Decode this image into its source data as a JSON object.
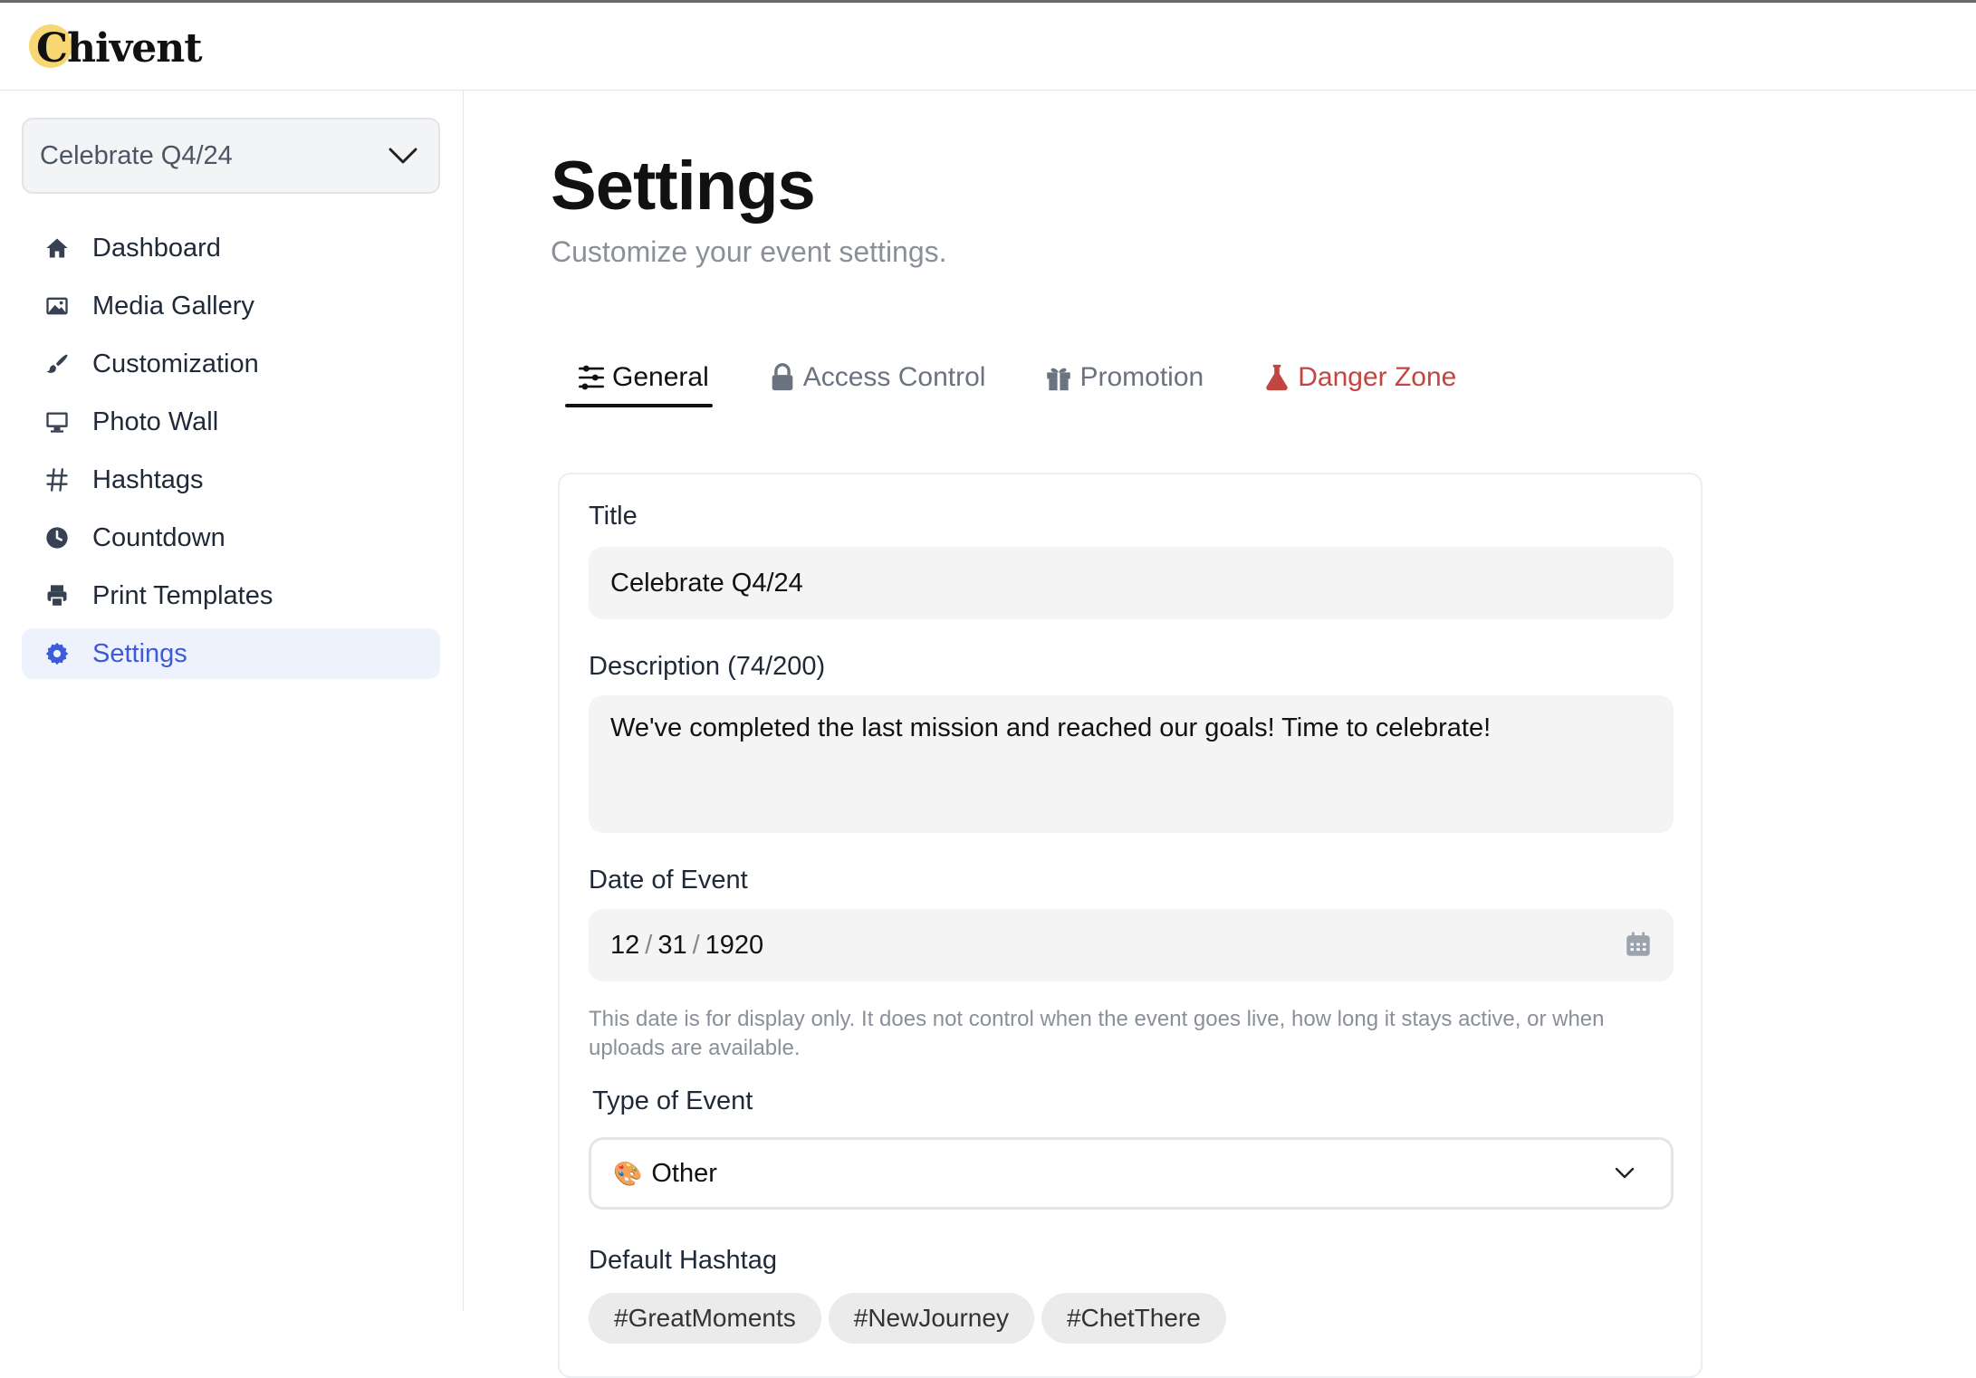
{
  "app": {
    "logo_text": "Chivent"
  },
  "sidebar": {
    "event_selector": {
      "value": "Celebrate Q4/24",
      "icon": "chevron-down-icon"
    },
    "items": [
      {
        "label": "Dashboard",
        "icon": "home-icon"
      },
      {
        "label": "Media Gallery",
        "icon": "image-icon"
      },
      {
        "label": "Customization",
        "icon": "paintbrush-icon"
      },
      {
        "label": "Photo Wall",
        "icon": "monitor-icon"
      },
      {
        "label": "Hashtags",
        "icon": "hashtag-icon"
      },
      {
        "label": "Countdown",
        "icon": "clock-icon"
      },
      {
        "label": "Print Templates",
        "icon": "printer-icon"
      },
      {
        "label": "Settings",
        "icon": "gear-icon",
        "active": true
      }
    ],
    "active_color": "#3b5bdb"
  },
  "main": {
    "title": "Settings",
    "subtitle": "Customize your event settings.",
    "tabs": [
      {
        "label": "General",
        "icon": "sliders-icon",
        "active": true
      },
      {
        "label": "Access Control",
        "icon": "lock-icon"
      },
      {
        "label": "Promotion",
        "icon": "gift-icon"
      },
      {
        "label": "Danger Zone",
        "icon": "flask-icon",
        "color": "#c0463f"
      }
    ],
    "form": {
      "title_label": "Title",
      "title_value": "Celebrate Q4/24",
      "description_label": "Description (74/200)",
      "description_value": "We've completed the last mission and reached our goals! Time to celebrate!",
      "date_label": "Date of Event",
      "date_month": "12",
      "date_sep": "/",
      "date_day": "31",
      "date_year": "1920",
      "date_help": "This date is for display only. It does not control when the event goes live, how long it stays active, or when uploads are available.",
      "type_label": "Type of Event",
      "type_value": "Other",
      "type_emoji": "🎨",
      "hashtag_label": "Default Hashtag",
      "hashtags": [
        "#GreatMoments",
        "#NewJourney",
        "#ChetThere"
      ]
    }
  }
}
